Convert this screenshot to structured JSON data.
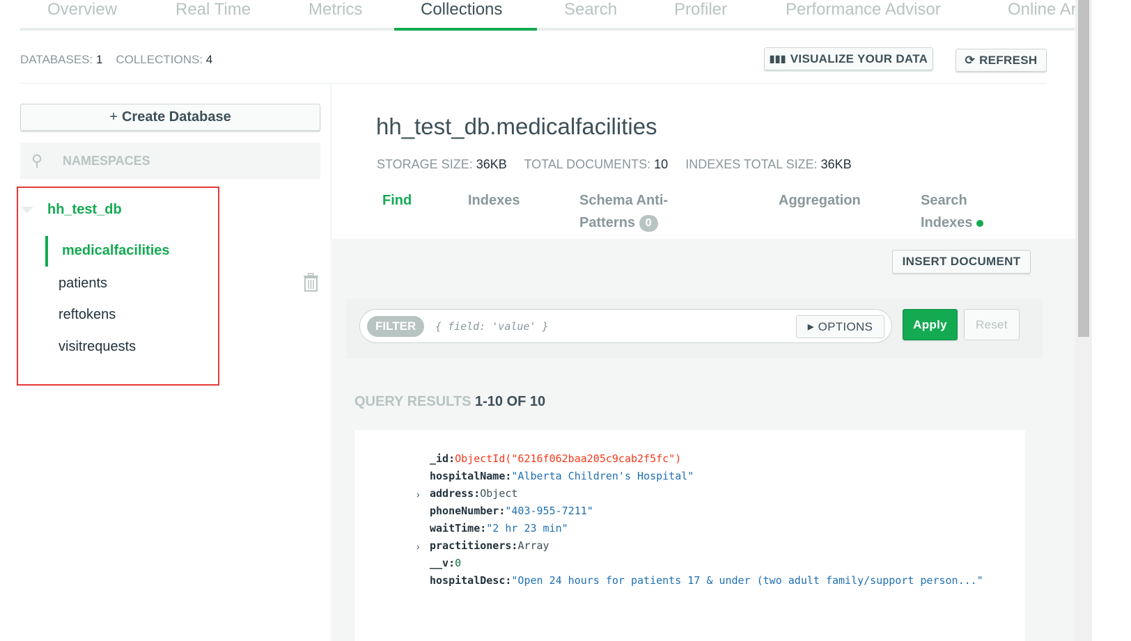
{
  "top_tabs": [
    "Overview",
    "Real Time",
    "Metrics",
    "Collections",
    "Search",
    "Profiler",
    "Performance Advisor",
    "Online Archive"
  ],
  "active_tab": "Collections",
  "stats": {
    "databases_label": "DATABASES:",
    "databases": "1",
    "collections_label": "COLLECTIONS:",
    "collections": "4"
  },
  "buttons": {
    "visualize": "VISUALIZE YOUR DATA",
    "refresh": "REFRESH",
    "create_db": "Create Database",
    "insert": "INSERT DOCUMENT",
    "options": "OPTIONS",
    "apply": "Apply",
    "reset": "Reset"
  },
  "sidebar": {
    "search_placeholder": "NAMESPACES",
    "database": "hh_test_db",
    "collections": [
      "medicalfacilities",
      "patients",
      "reftokens",
      "visitrequests"
    ],
    "selected": "medicalfacilities"
  },
  "collection": {
    "title": "hh_test_db.medicalfacilities",
    "storage_label": "STORAGE SIZE:",
    "storage": "36KB",
    "docs_label": "TOTAL DOCUMENTS:",
    "docs": "10",
    "idx_label": "INDEXES TOTAL SIZE:",
    "idx": "36KB"
  },
  "collection_tabs": {
    "find": "Find",
    "indexes": "Indexes",
    "schema1": "Schema Anti-",
    "schema2": "Patterns",
    "schema_badge": "0",
    "aggregation": "Aggregation",
    "search1": "Search",
    "search2": "Indexes"
  },
  "filter": {
    "label": "FILTER",
    "placeholder": "{ field: 'value' }"
  },
  "results": {
    "label": "QUERY RESULTS",
    "range": "1-10 OF 10"
  },
  "document": [
    {
      "key": "_id",
      "value": "ObjectId(\"6216f062baa205c9cab2f5fc\")",
      "type": "o"
    },
    {
      "key": "hospitalName",
      "value": "\"Alberta Children's Hospital\"",
      "type": "s"
    },
    {
      "key": "address",
      "value": "Object",
      "type": "p",
      "expandable": true
    },
    {
      "key": "phoneNumber",
      "value": "\"403-955-7211\"",
      "type": "s"
    },
    {
      "key": "waitTime",
      "value": "\"2 hr 23 min\"",
      "type": "s"
    },
    {
      "key": "practitioners",
      "value": "Array",
      "type": "p",
      "expandable": true
    },
    {
      "key": "__v",
      "value": "0",
      "type": "n"
    },
    {
      "key": "hospitalDesc",
      "value": "\"Open 24 hours for patients 17 & under (two adult family/support person...\"",
      "type": "s"
    }
  ],
  "colors": {
    "accent": "#13aa52",
    "highlight_box": "#e53935"
  }
}
